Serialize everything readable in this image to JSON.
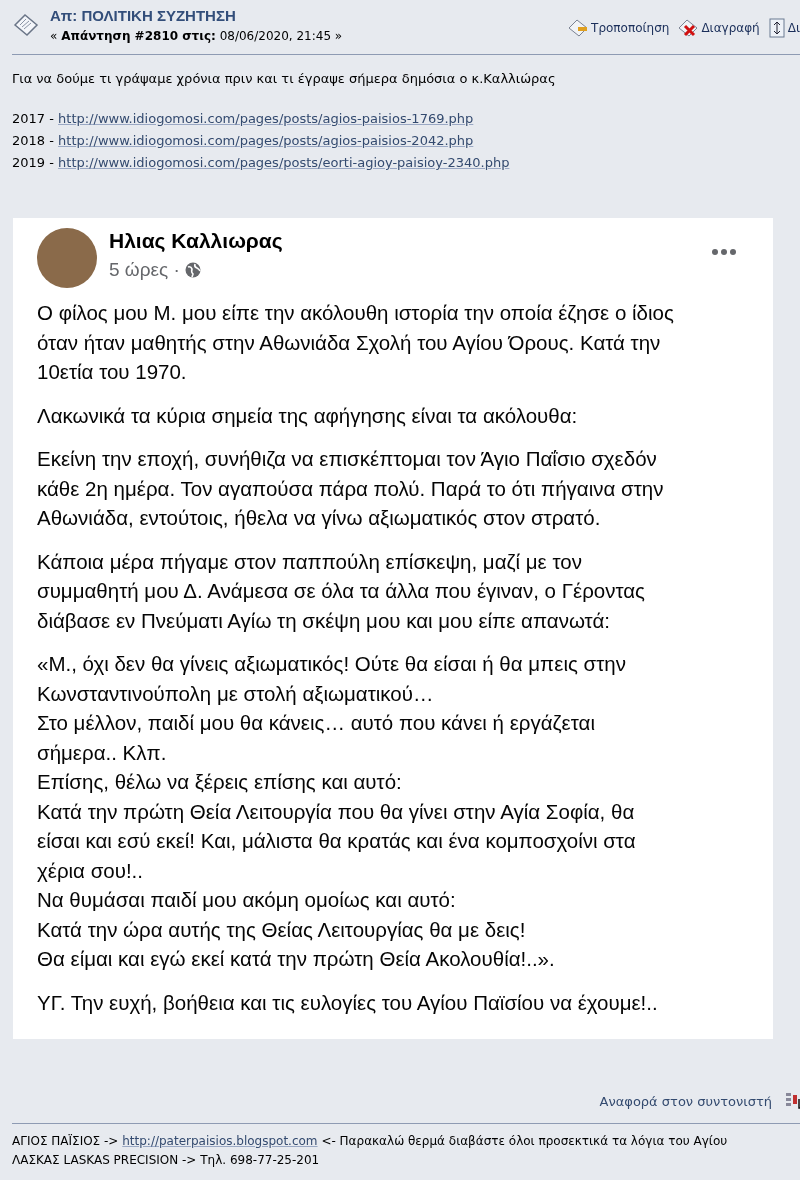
{
  "post_header": {
    "title": "Απ: ΠΟΛΙΤΙΚΗ ΣΥΖΗΤΗΣΗ",
    "reply_label": "Απάντηση #2810 στις:",
    "date": "08/06/2020, 21:45",
    "open_quote": "«",
    "close_quote": "»"
  },
  "actions": [
    {
      "kind": "edit",
      "label": "Τροποποίηση"
    },
    {
      "kind": "delete",
      "label": "Διαγραφή"
    },
    {
      "kind": "split",
      "label": "Δι"
    }
  ],
  "body": {
    "intro": "Για να δούμε τι γράψαμε χρόνια πριν και τι έγραψε σήμερα δημόσια ο κ.Καλλιώρας",
    "links": [
      {
        "year": "2017 -",
        "url": "http://www.idiogomosi.com/pages/posts/agios-paisios-1769.php"
      },
      {
        "year": "2018 -",
        "url": "http://www.idiogomosi.com/pages/posts/agios-paisios-2042.php"
      },
      {
        "year": "2019 -",
        "url": "http://www.idiogomosi.com/pages/posts/eorti-agioy-paisioy-2340.php"
      }
    ]
  },
  "embedded_post": {
    "author": "Ηλιας Καλλιωρας",
    "time": "5 ώρες ·",
    "paragraphs": [
      [
        "Ο φίλος μου Μ. μου είπε την ακόλουθη ιστορία την οποία έζησε ο ίδιος",
        "όταν ήταν μαθητής στην Αθωνιάδα Σχολή του Αγίου Όρους. Κατά την",
        "10ετία του 1970."
      ],
      [
        "Λακωνικά τα κύρια σημεία της αφήγησης είναι τα ακόλουθα:"
      ],
      [
        "Εκείνη την εποχή, συνήθιζα να επισκέπτομαι τον Άγιο Παΐσιο σχεδόν",
        "κάθε 2η ημέρα. Τον αγαπούσα πάρα πολύ. Παρά το ότι πήγαινα στην",
        "Αθωνιάδα, εντούτοις, ήθελα να γίνω αξιωματικός στον στρατό."
      ],
      [
        "Κάποια μέρα πήγαμε στον παππούλη επίσκεψη, μαζί με τον",
        "συμμαθητή μου Δ. Ανάμεσα σε όλα τα άλλα που έγιναν, ο Γέροντας",
        "διάβασε εν Πνεύματι Αγίω τη σκέψη μου και μου είπε απανωτά:"
      ],
      [
        "«Μ., όχι δεν θα γίνεις αξιωματικός! Ούτε θα είσαι ή θα μπεις στην",
        "Κωνσταντινούπολη με στολή αξιωματικού…",
        "Στο μέλλον, παιδί μου θα κάνεις… αυτό που κάνει ή εργάζεται",
        "σήμερα.. Κλπ.",
        "Επίσης, θέλω να ξέρεις επίσης και αυτό:",
        "Κατά την πρώτη Θεία Λειτουργία που θα γίνει στην Αγία Σοφία, θα",
        "είσαι και εσύ εκεί! Και, μάλιστα θα κρατάς και ένα κομποσχοίνι στα",
        "χέρια σου!..",
        "Να θυμάσαι παιδί μου ακόμη ομοίως και αυτό:",
        "Κατά την ώρα αυτής της Θείας Λειτουργίας θα με δεις!",
        "Θα είμαι και εγώ εκεί κατά την πρώτη Θεία Ακολουθία!..»."
      ],
      [
        "ΥΓ. Την ευχή, βοήθεια και τις ευλογίες του Αγίου Παϊσίου να έχουμε!.."
      ]
    ]
  },
  "report_link": "Αναφορά στον συντονιστή",
  "signature": [
    {
      "before": "ΑΓΙΟΣ ΠΑΪΣΙΟΣ ->",
      "url": "http://paterpaisios.blogspot.com",
      "after": "<- Παρακαλώ θερμά διαβάστε όλοι προσεκτικά τα λόγια του Αγίου"
    },
    {
      "before": "ΛΑΣΚΑΣ LASKAS PRECISION -> Τηλ. 698-77-25-201"
    }
  ]
}
